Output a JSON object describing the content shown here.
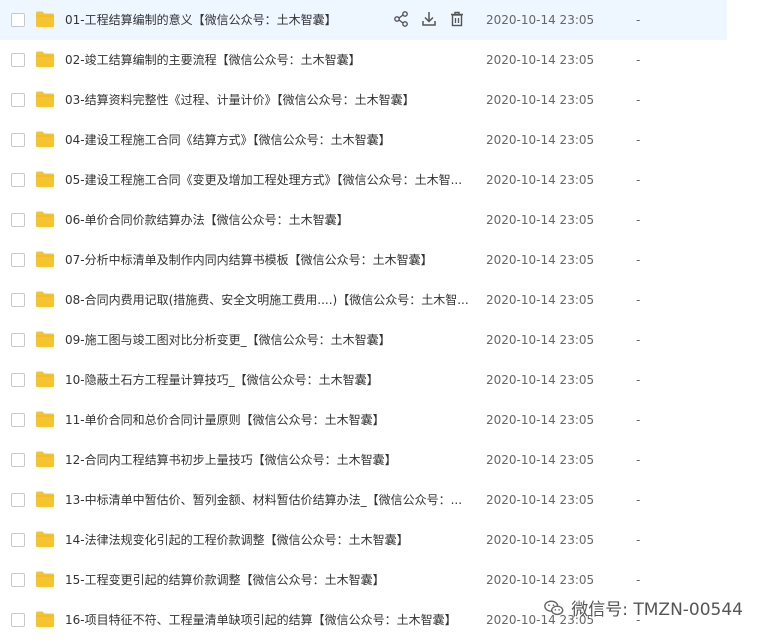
{
  "files": [
    {
      "name": "01-工程结算编制的意义【微信公众号：土木智囊】",
      "date": "2020-10-14 23:05",
      "size": "-"
    },
    {
      "name": "02-竣工结算编制的主要流程【微信公众号：土木智囊】",
      "date": "2020-10-14 23:05",
      "size": "-"
    },
    {
      "name": "03-结算资料完整性《过程、计量计价》【微信公众号：土木智囊】",
      "date": "2020-10-14 23:05",
      "size": "-"
    },
    {
      "name": "04-建设工程施工合同《结算方式》【微信公众号：土木智囊】",
      "date": "2020-10-14 23:05",
      "size": "-"
    },
    {
      "name": "05-建设工程施工合同《变更及增加工程处理方式》【微信公众号：土木智...",
      "date": "2020-10-14 23:05",
      "size": "-"
    },
    {
      "name": "06-单价合同价款结算办法【微信公众号：土木智囊】",
      "date": "2020-10-14 23:05",
      "size": "-"
    },
    {
      "name": "07-分析中标清单及制作内同内结算书模板【微信公众号：土木智囊】",
      "date": "2020-10-14 23:05",
      "size": "-"
    },
    {
      "name": "08-合同内费用记取(措施费、安全文明施工费用....)【微信公众号：土木智...",
      "date": "2020-10-14 23:05",
      "size": "-"
    },
    {
      "name": "09-施工图与竣工图对比分析变更_【微信公众号：土木智囊】",
      "date": "2020-10-14 23:05",
      "size": "-"
    },
    {
      "name": "10-隐蔽土石方工程量计算技巧_【微信公众号：土木智囊】",
      "date": "2020-10-14 23:05",
      "size": "-"
    },
    {
      "name": "11-单价合同和总价合同计量原则【微信公众号：土木智囊】",
      "date": "2020-10-14 23:05",
      "size": "-"
    },
    {
      "name": "12-合同内工程结算书初步上量技巧【微信公众号：土木智囊】",
      "date": "2020-10-14 23:05",
      "size": "-"
    },
    {
      "name": "13-中标清单中暂估价、暂列金额、材料暂估价结算办法_【微信公众号：...",
      "date": "2020-10-14 23:05",
      "size": "-"
    },
    {
      "name": "14-法律法规变化引起的工程价款调整【微信公众号：土木智囊】",
      "date": "2020-10-14 23:05",
      "size": "-"
    },
    {
      "name": "15-工程变更引起的结算价款调整【微信公众号：土木智囊】",
      "date": "2020-10-14 23:05",
      "size": "-"
    },
    {
      "name": "16-项目特征不符、工程量清单缺项引起的结算【微信公众号：土木智囊】",
      "date": "2020-10-14 23:05",
      "size": "-"
    }
  ],
  "watermark": {
    "text": "微信号: TMZN-00544"
  },
  "colors": {
    "folder": "#f7c431",
    "hover_row": "#eef6ff",
    "icon": "#555555"
  }
}
